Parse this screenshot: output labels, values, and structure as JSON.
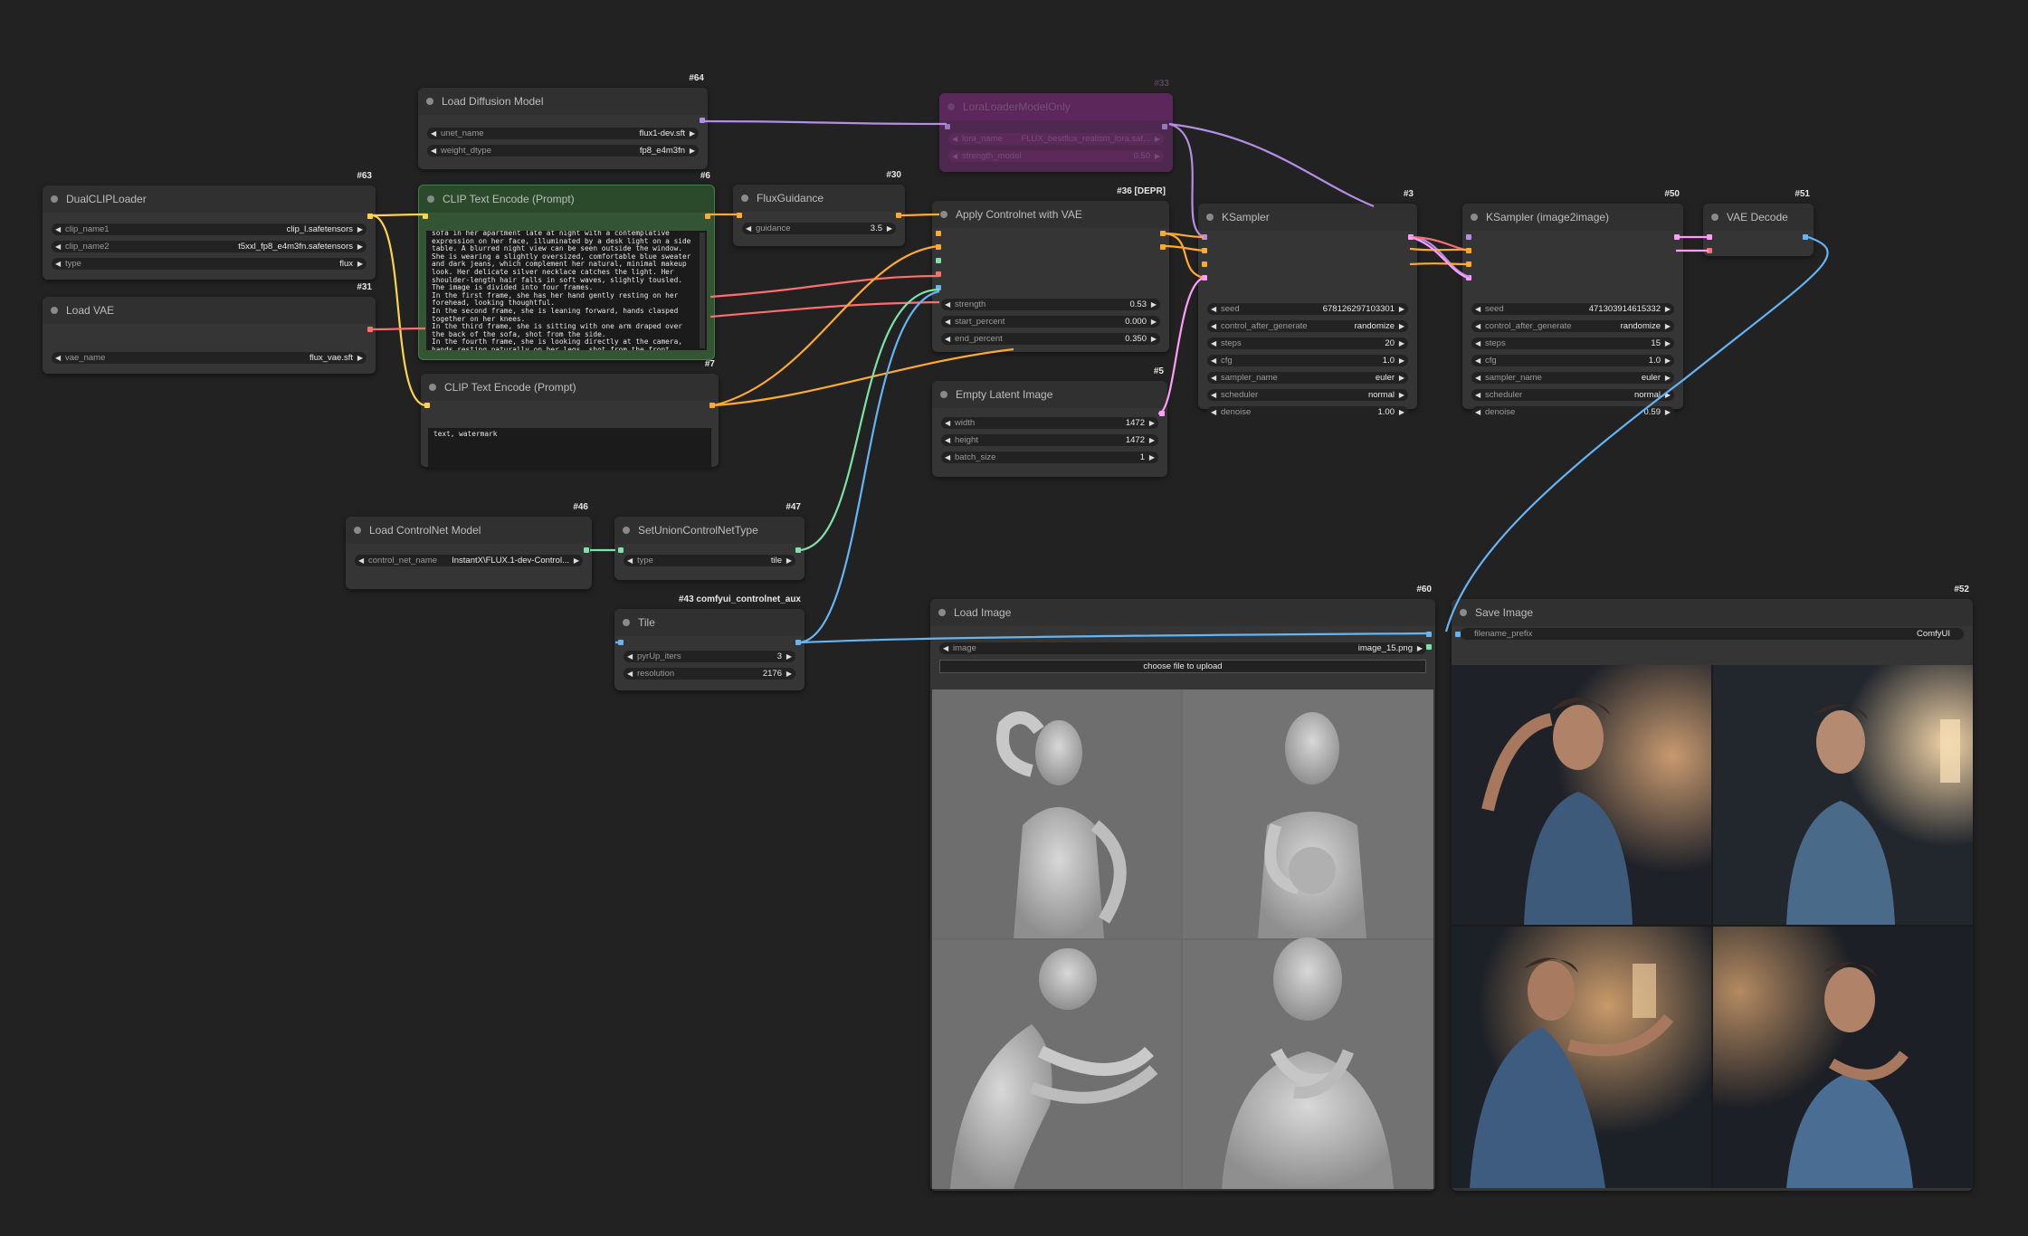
{
  "nodes": {
    "dualclip": {
      "id": "#63",
      "title": "DualCLIPLoader",
      "widgets": [
        {
          "label": "clip_name1",
          "value": "clip_l.safetensors"
        },
        {
          "label": "clip_name2",
          "value": "t5xxl_fp8_e4m3fn.safetensors"
        },
        {
          "label": "type",
          "value": "flux"
        }
      ]
    },
    "loadvae": {
      "id": "#31",
      "title": "Load VAE",
      "widgets": [
        {
          "label": "vae_name",
          "value": "flux_vae.sft"
        }
      ]
    },
    "diffusion": {
      "id": "#64",
      "title": "Load Diffusion Model",
      "widgets": [
        {
          "label": "unet_name",
          "value": "flux1-dev.sft"
        },
        {
          "label": "weight_dtype",
          "value": "fp8_e4m3fn"
        }
      ]
    },
    "clip_pos": {
      "id": "#6",
      "title": "CLIP Text Encode (Prompt)",
      "text": "sofa in her apartment late at night with a contemplative expression on her face, illuminated by a desk light on a side table. A blurred night view can be seen outside the window. She is wearing a slightly oversized, comfortable blue sweater and dark jeans, which complement her natural, minimal makeup look. Her delicate silver necklace catches the light. Her shoulder-length hair falls in soft waves, slightly tousled.\nThe image is divided into four frames.\nIn the first frame, she has her hand gently resting on her forehead, looking thoughtful.\nIn the second frame, she is leaning forward, hands clasped together on her knees.\nIn the third frame, she is sitting with one arm draped over the back of the sofa, shot from the side.\nIn the fourth frame, she is looking directly at the camera, hands resting naturally on her legs, shot from the front."
    },
    "clip_neg": {
      "id": "#7",
      "title": "CLIP Text Encode (Prompt)",
      "text": "text, watermark"
    },
    "flux_guidance": {
      "id": "#30",
      "title": "FluxGuidance",
      "widgets": [
        {
          "label": "guidance",
          "value": "3.5"
        }
      ]
    },
    "lora": {
      "id": "#33",
      "title": "LoraLoaderModelOnly",
      "widgets": [
        {
          "label": "lora_name",
          "value": "FLUX_bestflux_realism_lora.saf..."
        },
        {
          "label": "strength_model",
          "value": "0.50"
        }
      ]
    },
    "apply_cn": {
      "id": "#36 [DEPR]",
      "title": "Apply Controlnet with VAE",
      "widgets": [
        {
          "label": "strength",
          "value": "0.53"
        },
        {
          "label": "start_percent",
          "value": "0.000"
        },
        {
          "label": "end_percent",
          "value": "0.350"
        }
      ]
    },
    "empty_latent": {
      "id": "#5",
      "title": "Empty Latent Image",
      "widgets": [
        {
          "label": "width",
          "value": "1472"
        },
        {
          "label": "height",
          "value": "1472"
        },
        {
          "label": "batch_size",
          "value": "1"
        }
      ]
    },
    "ksampler": {
      "id": "#3",
      "title": "KSampler",
      "widgets": [
        {
          "label": "seed",
          "value": "678126297103301"
        },
        {
          "label": "control_after_generate",
          "value": "randomize"
        },
        {
          "label": "steps",
          "value": "20"
        },
        {
          "label": "cfg",
          "value": "1.0"
        },
        {
          "label": "sampler_name",
          "value": "euler"
        },
        {
          "label": "scheduler",
          "value": "normal"
        },
        {
          "label": "denoise",
          "value": "1.00"
        }
      ]
    },
    "ksampler2": {
      "id": "#50",
      "title": "KSampler (image2image)",
      "widgets": [
        {
          "label": "seed",
          "value": "471303914615332"
        },
        {
          "label": "control_after_generate",
          "value": "randomize"
        },
        {
          "label": "steps",
          "value": "15"
        },
        {
          "label": "cfg",
          "value": "1.0"
        },
        {
          "label": "sampler_name",
          "value": "euler"
        },
        {
          "label": "scheduler",
          "value": "normal"
        },
        {
          "label": "denoise",
          "value": "0.59"
        }
      ]
    },
    "vae_decode": {
      "id": "#51",
      "title": "VAE Decode"
    },
    "load_cn": {
      "id": "#46",
      "title": "Load ControlNet Model",
      "widgets": [
        {
          "label": "control_net_name",
          "value": "InstantX\\FLUX.1-dev-Control..."
        }
      ]
    },
    "set_union": {
      "id": "#47",
      "title": "SetUnionControlNetType",
      "widgets": [
        {
          "label": "type",
          "value": "tile"
        }
      ]
    },
    "tile": {
      "id": "#43 comfyui_controlnet_aux",
      "title": "Tile",
      "widgets": [
        {
          "label": "pyrUp_iters",
          "value": "3"
        },
        {
          "label": "resolution",
          "value": "2176"
        }
      ]
    },
    "load_image": {
      "id": "#60",
      "title": "Load Image",
      "widgets": [
        {
          "label": "image",
          "value": "image_15.png"
        }
      ],
      "upload_label": "choose file to upload"
    },
    "save_image": {
      "id": "#52",
      "title": "Save Image",
      "widgets": [
        {
          "label": "filename_prefix",
          "value": "ComfyUI"
        }
      ]
    }
  },
  "colors": {
    "background": "#222222",
    "node": "#353535",
    "clip_node": "#335533",
    "lora_node": "#5a2a5a",
    "model_wire": "#b48ee6",
    "clip_wire": "#ffd24d",
    "vae_wire": "#ff6e6e",
    "cond_wire": "#ffa931",
    "latent_wire": "#ff9cf9",
    "image_wire": "#64b5f6",
    "controlnet_wire": "#7ee2a8"
  }
}
